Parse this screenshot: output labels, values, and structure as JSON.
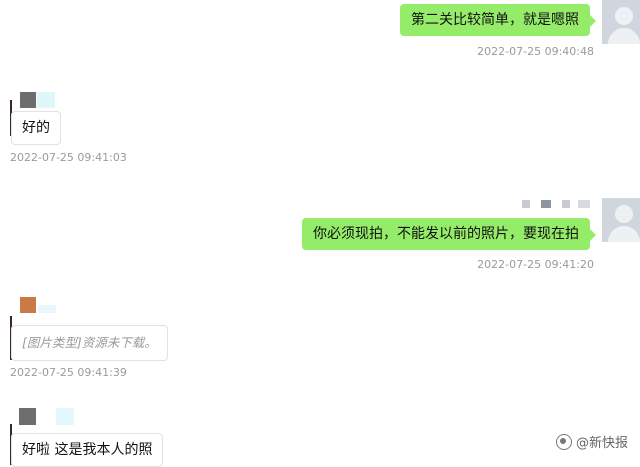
{
  "messages": [
    {
      "side": "out",
      "text": "第二关比较简单，就是嗯照",
      "time": "2022-07-25 09:40:48"
    },
    {
      "side": "in",
      "text": "好的",
      "time": "2022-07-25 09:41:03"
    },
    {
      "side": "out",
      "text": "你必须现拍，不能发以前的照片，要现在拍",
      "time": "2022-07-25 09:41:20"
    },
    {
      "side": "in",
      "text": "[图片类型]资源未下载。",
      "time": "2022-07-25 09:41:39"
    },
    {
      "side": "in",
      "text": "好啦 这是我本人的照",
      "time": ""
    }
  ],
  "watermark": "@新快报",
  "colors": {
    "outgoing_bubble": "#95ec69",
    "incoming_bubble": "#ffffff",
    "timestamp": "#9a9a9a"
  }
}
